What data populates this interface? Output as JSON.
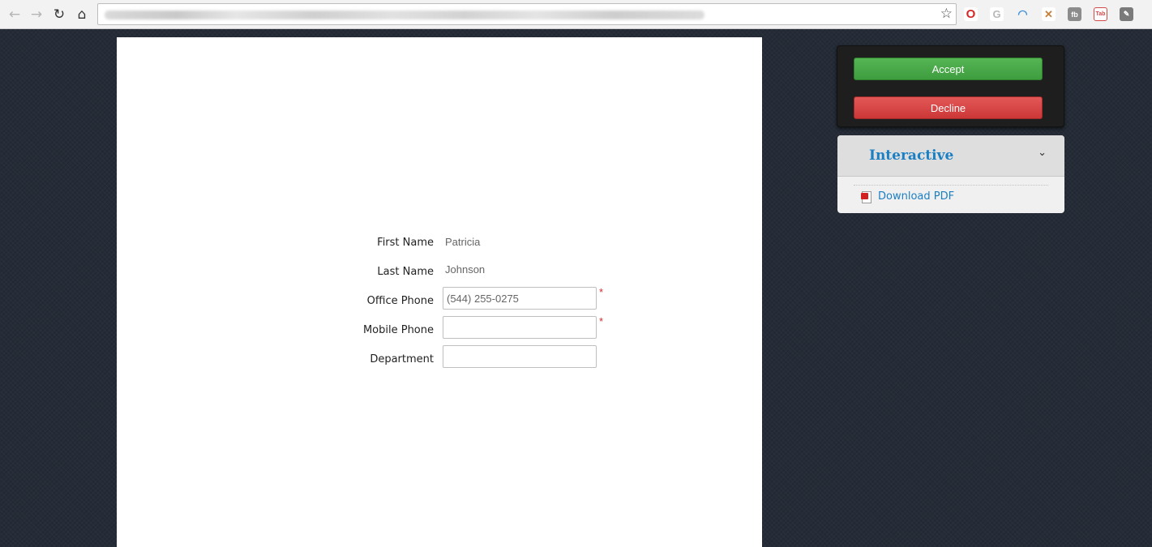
{
  "browser": {
    "back_icon": "←",
    "forward_icon": "→",
    "reload_icon": "↻",
    "home_icon": "⌂",
    "bookmark_icon": "☆",
    "extensions": [
      {
        "name": "opera-icon",
        "glyph": "O",
        "color": "#d42828"
      },
      {
        "name": "grammarly-icon",
        "glyph": "G",
        "color": "#b9b9b9"
      },
      {
        "name": "rainbow-icon",
        "glyph": "◠",
        "color": "#3d8fd6"
      },
      {
        "name": "translate-icon",
        "glyph": "✕",
        "color": "#c6803d"
      },
      {
        "name": "fb-icon",
        "glyph": "fb",
        "color": "#8c8c8c"
      },
      {
        "name": "tab-icon",
        "glyph": "Tab",
        "color": "#d04a4a"
      },
      {
        "name": "evernote-icon",
        "glyph": "✎",
        "color": "#7a7a7a"
      }
    ]
  },
  "form": {
    "first_name": {
      "label": "First Name",
      "value": "Patricia"
    },
    "last_name": {
      "label": "Last Name",
      "value": "Johnson"
    },
    "office_phone": {
      "label": "Office Phone",
      "value": "(544) 255-0275",
      "required_mark": "*"
    },
    "mobile_phone": {
      "label": "Mobile Phone",
      "value": "",
      "required_mark": "*"
    },
    "department": {
      "label": "Department",
      "value": ""
    }
  },
  "actions": {
    "accept_label": "Accept",
    "decline_label": "Decline",
    "accept_color": "#4aab49",
    "decline_color": "#d94545"
  },
  "interactive_panel": {
    "title": "Interactive",
    "chevron_icon": "⌄",
    "download_label": "Download PDF",
    "link_color": "#1b7fc4"
  }
}
